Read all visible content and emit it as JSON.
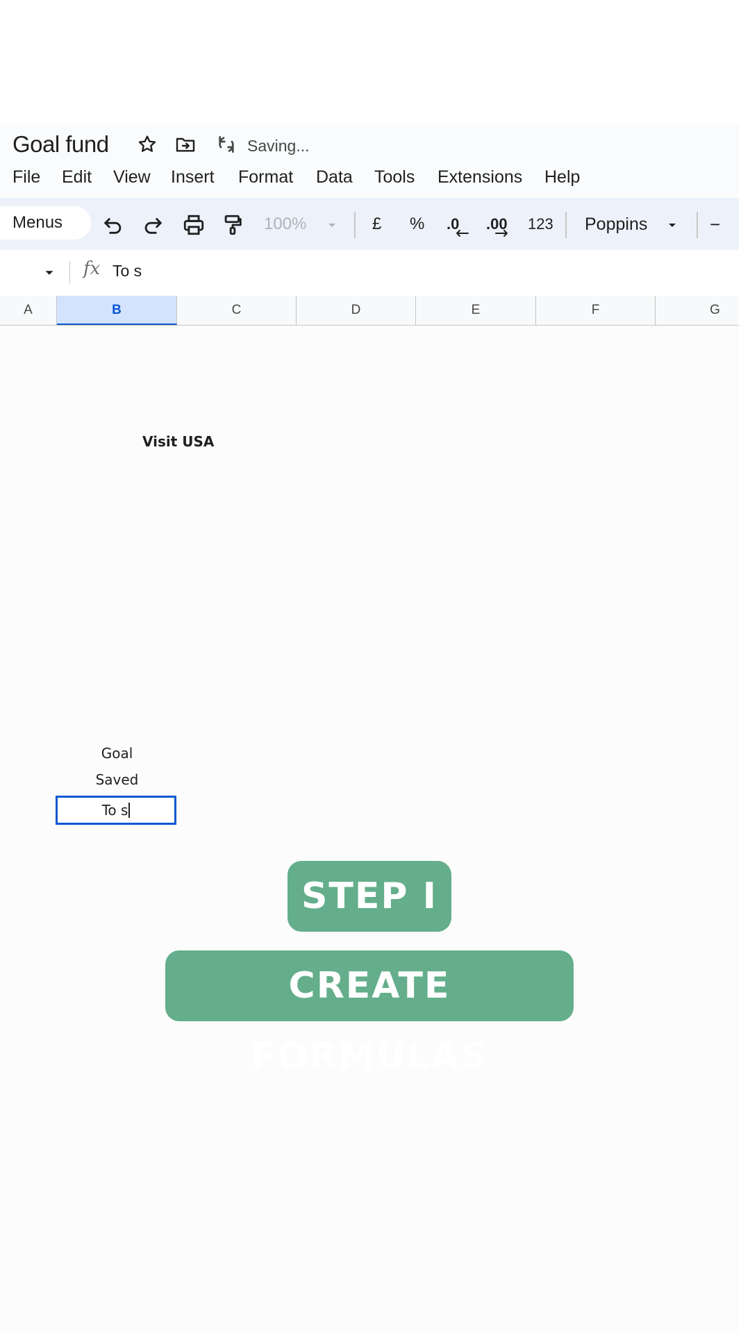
{
  "document": {
    "title": "Goal fund",
    "status": "Saving..."
  },
  "menu": [
    "File",
    "Edit",
    "View",
    "Insert",
    "Format",
    "Data",
    "Tools",
    "Extensions",
    "Help"
  ],
  "toolbar": {
    "menus_label": "Menus",
    "zoom": "100%",
    "currency": "£",
    "percent": "%",
    "decrease_decimal": ".0",
    "increase_decimal": ".00",
    "number_format": "123",
    "font": "Poppins",
    "minus": "−"
  },
  "formula_bar": {
    "fx_label": "fx",
    "value": "To s"
  },
  "columns": [
    "A",
    "B",
    "C",
    "D",
    "E",
    "F",
    "G"
  ],
  "selected_column": "B",
  "cells": {
    "title": "Visit USA",
    "goal": "Goal",
    "saved": "Saved",
    "editing": "To s"
  },
  "overlay": {
    "step": "STEP I",
    "caption": "CREATE FORMULAS"
  },
  "colors": {
    "accent": "#0b57d0",
    "caption_bg": "#64ae8b"
  }
}
